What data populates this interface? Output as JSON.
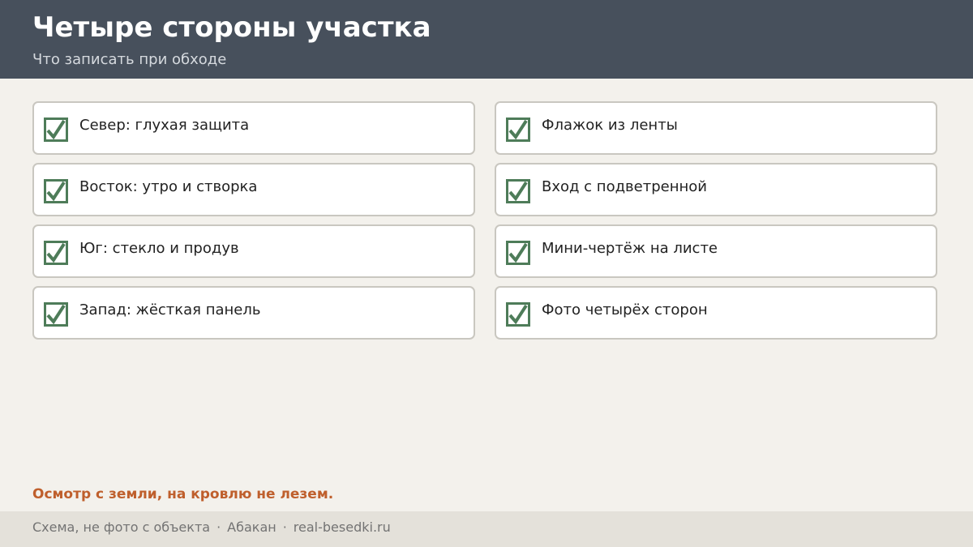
{
  "header": {
    "title": "Четыре стороны участка",
    "subtitle": "Что записать при обходе"
  },
  "checklist": {
    "left": [
      {
        "label": "Север: глухая защита",
        "checked": true
      },
      {
        "label": "Восток: утро и створка",
        "checked": true
      },
      {
        "label": "Юг: стекло и продув",
        "checked": true
      },
      {
        "label": "Запад: жёсткая панель",
        "checked": true
      }
    ],
    "right": [
      {
        "label": "Флажок из ленты",
        "checked": true
      },
      {
        "label": "Вход с подветренной",
        "checked": true
      },
      {
        "label": "Мини-чертёж на листе",
        "checked": true
      },
      {
        "label": "Фото четырёх сторон",
        "checked": true
      }
    ]
  },
  "note": "Осмотр с земли, на кровлю не лезем.",
  "footer": {
    "parts": [
      "Схема, не фото с объекта",
      "Абакан",
      "real-besedki.ru"
    ],
    "separator": "·"
  },
  "icons": {
    "checkbox": "checkbox-checked-icon"
  },
  "colors": {
    "header_bg": "#47505c",
    "page_bg": "#f3f1ec",
    "check_green": "#4e7c59",
    "note_accent": "#bf5f2c",
    "footer_bg": "#e4e1da"
  }
}
